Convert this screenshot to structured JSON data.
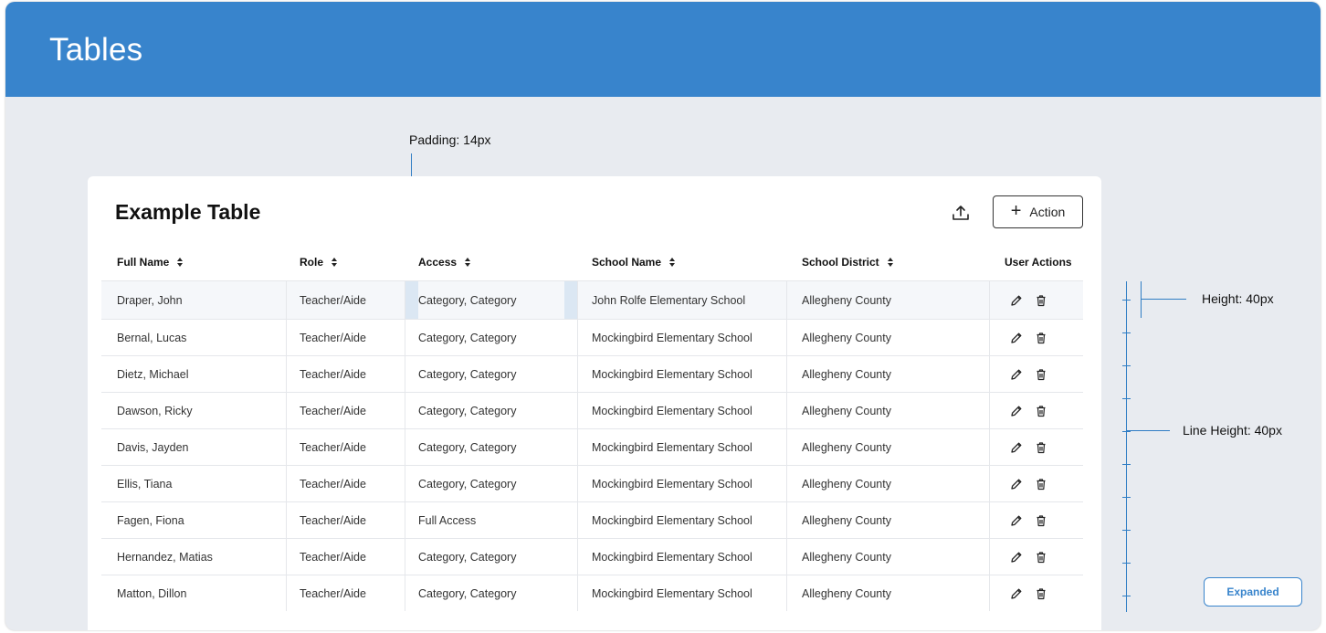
{
  "header": {
    "title": "Tables"
  },
  "annotations": {
    "padding": "Padding: 14px",
    "height": "Height: 40px",
    "line_height": "Line Height: 40px"
  },
  "card": {
    "title": "Example Table",
    "export_icon": "upload-icon",
    "action_label": "Action",
    "action_icon": "plus-icon"
  },
  "table": {
    "columns": [
      "Full Name",
      "Role",
      "Access",
      "School Name",
      "School District",
      "User Actions"
    ],
    "sortable": [
      true,
      true,
      true,
      true,
      true,
      false
    ],
    "rows": [
      {
        "name": "Draper, John",
        "role": "Teacher/Aide",
        "access": "Category, Category",
        "school": "John Rolfe Elementary School",
        "district": "Allegheny County"
      },
      {
        "name": "Bernal, Lucas",
        "role": "Teacher/Aide",
        "access": "Category, Category",
        "school": "Mockingbird Elementary School",
        "district": "Allegheny County"
      },
      {
        "name": "Dietz, Michael",
        "role": "Teacher/Aide",
        "access": "Category, Category",
        "school": "Mockingbird Elementary School",
        "district": "Allegheny County"
      },
      {
        "name": "Dawson, Ricky",
        "role": "Teacher/Aide",
        "access": "Category, Category",
        "school": "Mockingbird Elementary School",
        "district": "Allegheny County"
      },
      {
        "name": "Davis, Jayden",
        "role": "Teacher/Aide",
        "access": "Category, Category",
        "school": "Mockingbird Elementary School",
        "district": "Allegheny County"
      },
      {
        "name": "Ellis, Tiana",
        "role": "Teacher/Aide",
        "access": "Category, Category",
        "school": "Mockingbird Elementary School",
        "district": "Allegheny County"
      },
      {
        "name": "Fagen, Fiona",
        "role": "Teacher/Aide",
        "access": "Full Access",
        "school": "Mockingbird Elementary School",
        "district": "Allegheny County"
      },
      {
        "name": "Hernandez, Matias",
        "role": "Teacher/Aide",
        "access": "Category, Category",
        "school": "Mockingbird Elementary School",
        "district": "Allegheny County"
      },
      {
        "name": "Matton, Dillon",
        "role": "Teacher/Aide",
        "access": "Category, Category",
        "school": "Mockingbird Elementary School",
        "district": "Allegheny County"
      }
    ],
    "row_action_icons": [
      "pencil-icon",
      "trash-icon"
    ]
  },
  "footer": {
    "expanded_label": "Expanded"
  },
  "colors": {
    "brand": "#3884cc",
    "background": "#e8ebf0",
    "highlight": "#dbe7f3"
  }
}
